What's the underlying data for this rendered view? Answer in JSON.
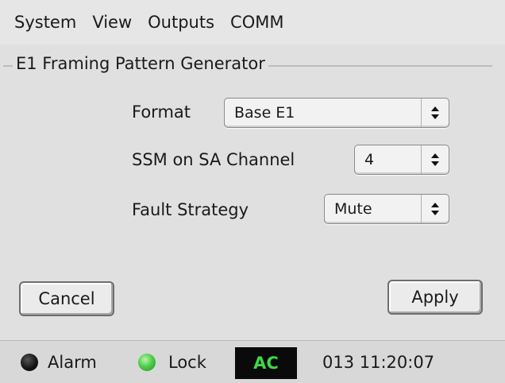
{
  "menubar": {
    "items": [
      "System",
      "View",
      "Outputs",
      "COMM"
    ]
  },
  "group": {
    "title": "E1 Framing Pattern Generator"
  },
  "fields": {
    "format": {
      "label": "Format",
      "value": "Base E1"
    },
    "ssm": {
      "label": "SSM on SA Channel",
      "value": "4"
    },
    "fault": {
      "label": "Fault Strategy",
      "value": "Mute"
    }
  },
  "buttons": {
    "cancel": "Cancel",
    "apply": "Apply"
  },
  "status": {
    "alarm_label": "Alarm",
    "lock_label": "Lock",
    "ac_label": "AC",
    "datetime": "013 11:20:07",
    "alarm_color": "#1a1a1a",
    "lock_color": "#3fc24a",
    "ac_color": "#3ed84a"
  },
  "icons": {
    "select_arrows": "updown-arrows-icon"
  }
}
